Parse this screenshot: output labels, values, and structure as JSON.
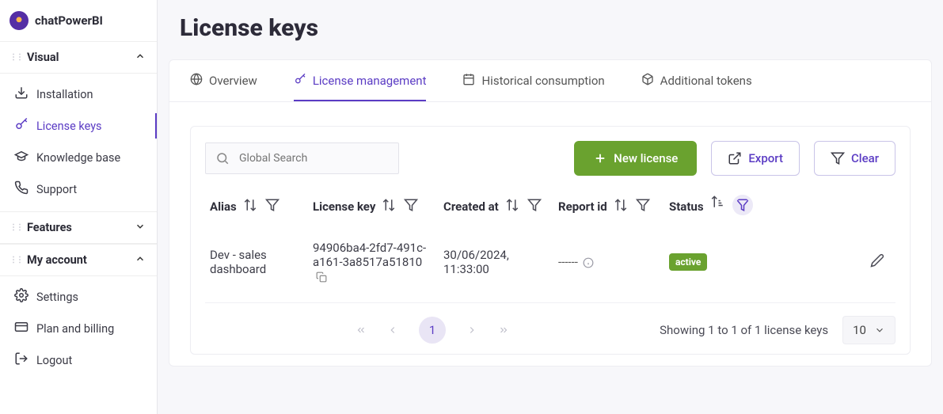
{
  "brand": "chatPowerBI",
  "page_title": "License keys",
  "sidebar": {
    "sections": [
      {
        "title": "Visual",
        "expanded": true,
        "items": [
          {
            "label": "Installation",
            "name": "installation",
            "icon": "download"
          },
          {
            "label": "License keys",
            "name": "license-keys",
            "icon": "key",
            "active": true
          },
          {
            "label": "Knowledge base",
            "name": "knowledge-base",
            "icon": "grad"
          },
          {
            "label": "Support",
            "name": "support",
            "icon": "phone"
          }
        ]
      },
      {
        "title": "Features",
        "expanded": false,
        "items": []
      },
      {
        "title": "My account",
        "expanded": true,
        "items": [
          {
            "label": "Settings",
            "name": "settings",
            "icon": "gear"
          },
          {
            "label": "Plan and billing",
            "name": "plan-billing",
            "icon": "card"
          },
          {
            "label": "Logout",
            "name": "logout",
            "icon": "logout"
          }
        ]
      }
    ]
  },
  "tabs": [
    {
      "label": "Overview",
      "name": "overview",
      "icon": "globe"
    },
    {
      "label": "License management",
      "name": "license-management",
      "icon": "key",
      "active": true
    },
    {
      "label": "Historical consumption",
      "name": "historical-consumption",
      "icon": "calendar"
    },
    {
      "label": "Additional tokens",
      "name": "additional-tokens",
      "icon": "cube"
    }
  ],
  "toolbar": {
    "search_placeholder": "Global Search",
    "new_label": "New license",
    "export_label": "Export",
    "clear_label": "Clear"
  },
  "columns": [
    {
      "label": "Alias",
      "name": "alias"
    },
    {
      "label": "License key",
      "name": "license-key"
    },
    {
      "label": "Created at",
      "name": "created-at"
    },
    {
      "label": "Report id",
      "name": "report-id"
    },
    {
      "label": "Status",
      "name": "status",
      "filter_highlight": true
    }
  ],
  "rows": [
    {
      "alias": "Dev - sales dashboard",
      "license_key": "94906ba4-2fd7-491c-a161-3a8517a51810",
      "created_at": "30/06/2024, 11:33:00",
      "report_id": "------",
      "status": "active"
    }
  ],
  "pager": {
    "page": "1",
    "info": "Showing 1 to 1 of 1 license keys",
    "page_size": "10"
  }
}
